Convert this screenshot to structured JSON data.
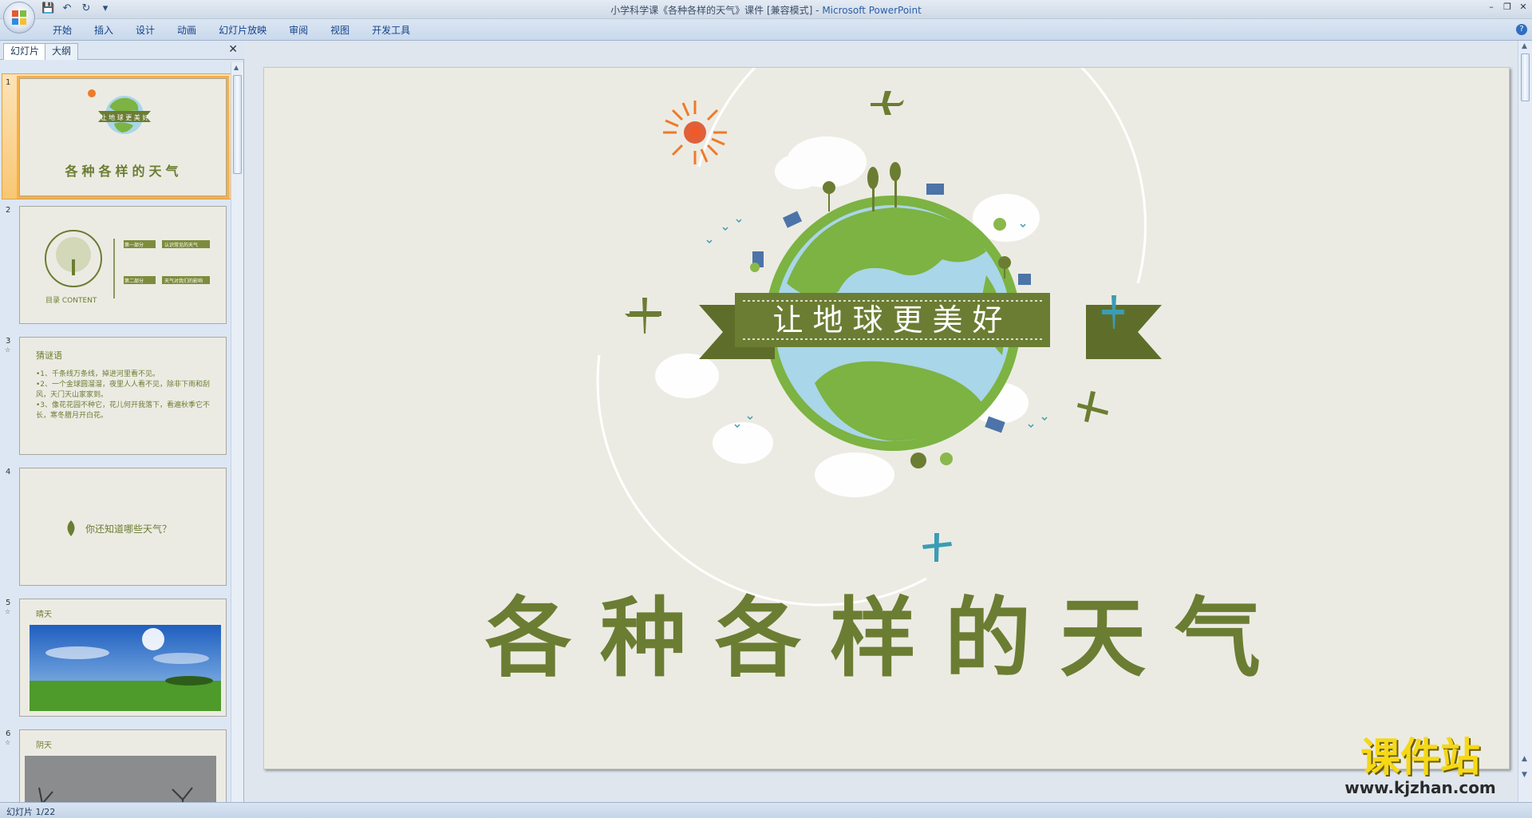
{
  "window": {
    "title": "小学科学课《各种各样的天气》课件 [兼容模式] - ",
    "app_name": "Microsoft PowerPoint"
  },
  "ribbon": {
    "tabs": [
      "开始",
      "插入",
      "设计",
      "动画",
      "幻灯片放映",
      "审阅",
      "视图",
      "开发工具"
    ]
  },
  "left_pane": {
    "tabs": [
      "幻灯片",
      "大纲"
    ],
    "slides": [
      {
        "num": "1",
        "title": "各种各样的天气",
        "banner": "让地球更美好"
      },
      {
        "num": "2",
        "heading": "目录 CONTENT",
        "items": [
          "第一部分",
          "认识常见的天气",
          "第二部分",
          "天气对我们的影响"
        ]
      },
      {
        "num": "3",
        "heading": "猜谜语",
        "lines": [
          "•1、千条线万条线，掉进河里看不见。",
          "•2、一个金球圆溜溜，夜里人人看不见，除非下雨和刮风，天门天山家家到。",
          "•3、像花花园不种它，花儿何开我落下，看遍秋季它不长，寒冬腊月开白花。"
        ]
      },
      {
        "num": "4",
        "text": "你还知道哪些天气？"
      },
      {
        "num": "5",
        "heading": "晴天"
      },
      {
        "num": "6",
        "heading": "阴天"
      }
    ]
  },
  "slide": {
    "banner": "让地球更美好",
    "title": "各种各样的天气"
  },
  "status": {
    "slide_counter": "幻灯片 1/22"
  },
  "watermark": {
    "brand": "课件站",
    "url": "www.kjzhan.com"
  },
  "colors": {
    "accent_green": "#6b7d32",
    "slide_bg": "#ecebe3",
    "sun_orange": "#f07a28",
    "ocean_blue": "#a9d6e8",
    "land_green": "#7cb342",
    "plane_teal": "#3a9db5",
    "selection": "#f8c774"
  }
}
